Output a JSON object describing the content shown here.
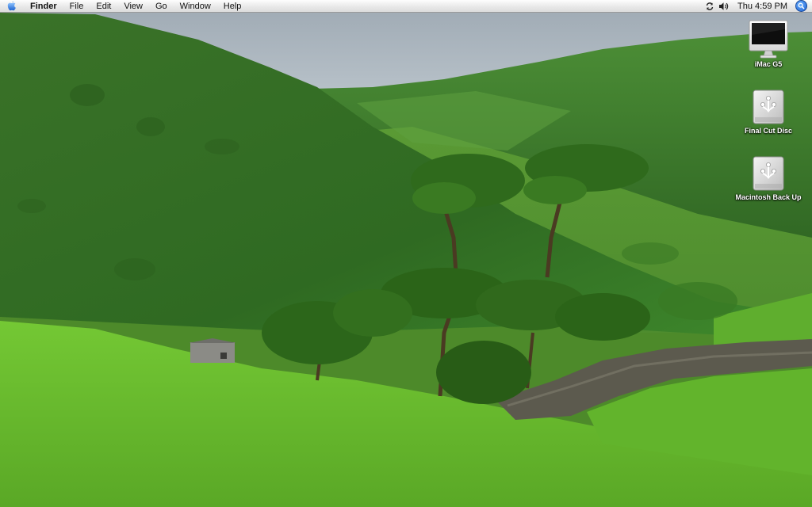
{
  "menubar": {
    "apple_icon": "apple-logo-icon",
    "app_name": "Finder",
    "menus": [
      "File",
      "Edit",
      "View",
      "Go",
      "Window",
      "Help"
    ],
    "status_icons": [
      "sync-icon",
      "volume-icon"
    ],
    "clock": "Thu 4:59 PM",
    "spotlight_icon": "spotlight-search-icon"
  },
  "desktop": {
    "wallpaper": "green-valley-landscape",
    "icons": [
      {
        "label": "iMac G5",
        "icon": "imac-computer-icon"
      },
      {
        "label": "Final Cut Disc",
        "icon": "firewire-disk-icon"
      },
      {
        "label": "Macintosh Back Up",
        "icon": "firewire-disk-icon"
      }
    ]
  },
  "colors": {
    "menubar": "#ececec",
    "sky": "#aab4bc",
    "hills_dark": "#3e7a2a",
    "meadow": "#6cc52c",
    "spotlight": "#1b5fd1"
  }
}
